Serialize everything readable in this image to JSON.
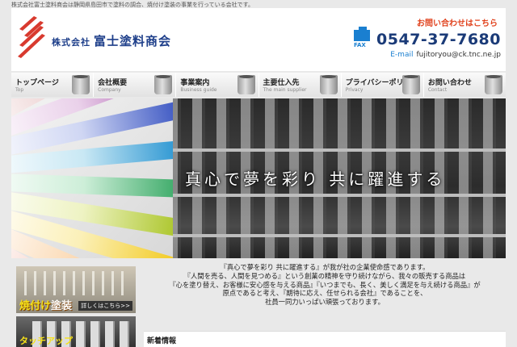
{
  "top_note": "株式会社富士塗料商会は静岡県島田市で塗料の調合、焼付け塗装の事業を行っている会社です。",
  "logo": {
    "prefix": "株式会社",
    "name": "富士塗料商会"
  },
  "contact": {
    "heading": "お問い合わせはこちら",
    "fax_label": "FAX",
    "phone": "0547-37-7680",
    "email_label": "E-mail",
    "email": "fujitoryou@ck.tnc.ne.jp"
  },
  "nav": [
    {
      "jp": "トップページ",
      "en": "Top"
    },
    {
      "jp": "会社概要",
      "en": "Company"
    },
    {
      "jp": "事業案内",
      "en": "Business guide"
    },
    {
      "jp": "主要仕入先",
      "en": "The main supplier"
    },
    {
      "jp": "プライバシーポリシー",
      "en": "Privacy"
    },
    {
      "jp": "お問い合わせ",
      "en": "Contact"
    }
  ],
  "hero": {
    "caption": "真心で夢を彩り 共に躍進する"
  },
  "banners": {
    "baking": {
      "title_a": "焼付け",
      "title_b": "塗装",
      "more": "詳しくはこちら>>"
    },
    "touchup": {
      "title": "タッチアップ"
    }
  },
  "intro": [
    "『真心で夢を彩り 共に躍進する』が我が社の企業使命感であります。",
    "『人間を売る、人間を見つめる』という創業の精神を守り続けながら、我々の販売する商品は",
    "『心を塗り替え、お客様に安心感を与える商品』『いつまでも、長く、美しく満足を与え続ける商品』が",
    "原点であると考え、『期待に応え、任せられる会社』であることを、",
    "社員一同力いっぱい頑張っております。"
  ],
  "news": {
    "heading": "新着情報"
  },
  "colors": {
    "brand_blue": "#1e3f8a",
    "accent_red": "#e0401b",
    "link_blue": "#1a7fd0"
  }
}
